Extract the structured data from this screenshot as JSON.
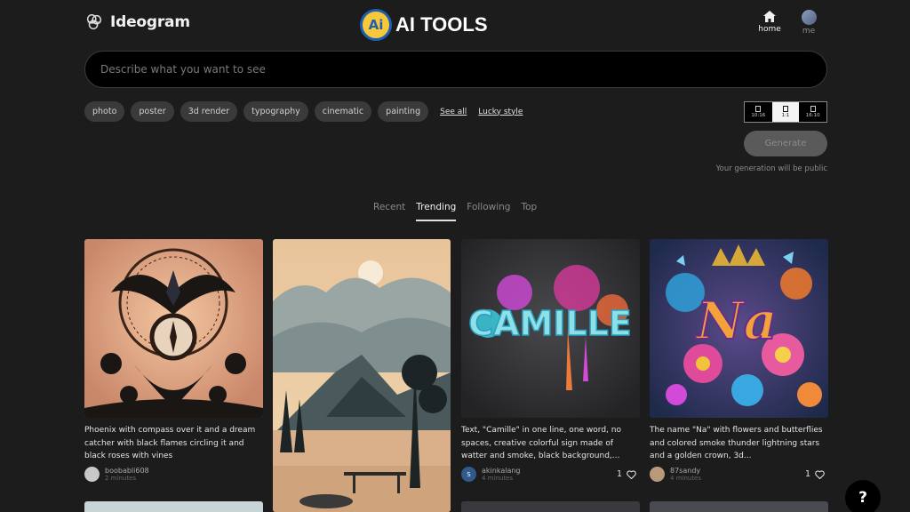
{
  "header": {
    "app_name": "Ideogram",
    "badge_mark": "Ai",
    "badge_text": "AI TOOLS",
    "nav": {
      "home_label": "home",
      "me_label": "me"
    }
  },
  "prompt": {
    "placeholder": "Describe what you want to see"
  },
  "chips": [
    "photo",
    "poster",
    "3d render",
    "typography",
    "cinematic",
    "painting"
  ],
  "links": {
    "see_all": "See all",
    "lucky_style": "Lucky style"
  },
  "aspect_ratios": [
    {
      "label": "10:16",
      "active": false
    },
    {
      "label": "1:1",
      "active": true
    },
    {
      "label": "16:10",
      "active": false
    }
  ],
  "generate": {
    "label": "Generate",
    "note": "Your generation will be public"
  },
  "tabs": [
    "Recent",
    "Trending",
    "Following",
    "Top"
  ],
  "active_tab": "Trending",
  "cards": [
    {
      "caption": "Phoenix with compass over it and a dream catcher with black flames circling it and black roses with vines",
      "user": "boobabli608",
      "time": "2 minutes",
      "likes": ""
    },
    {
      "caption": "Text, \"Camille\" in one line, one word, no spaces, creative colorful sign made of watter and smoke, black background,...",
      "user": "akinkalang",
      "user_initial": "S",
      "time": "4 minutes",
      "likes": "1"
    },
    {
      "caption": "The name \"Na\" with flowers and butterflies and colored smoke thunder lightning stars and a golden crown, 3d...",
      "user": "87sandy",
      "time": "4 minutes",
      "likes": "1"
    }
  ],
  "image_text": {
    "camille": "CAMILLE",
    "na": "Na"
  },
  "help": {
    "label": "?"
  },
  "colors": {
    "background": "#1c1c1c",
    "prompt_bg": "#000000",
    "chip_bg": "#3a3a3a",
    "badge_yellow": "#f7c83a",
    "badge_blue": "#1e5fb0"
  }
}
